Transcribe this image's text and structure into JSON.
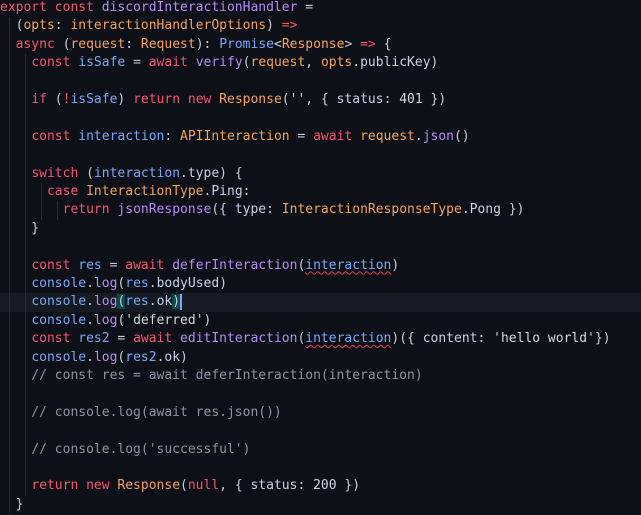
{
  "editor": {
    "current_line": 16,
    "lines": [
      [
        [
          "export const ",
          "kw"
        ],
        [
          "discordInteractionHandler",
          "fn"
        ],
        [
          " =",
          "p"
        ]
      ],
      [
        [
          "  (",
          "p"
        ],
        [
          "opts",
          "param"
        ],
        [
          ": ",
          "p"
        ],
        [
          "interactionHandlerOptions",
          "type"
        ],
        [
          ") ",
          "p"
        ],
        [
          "=>",
          "kw"
        ]
      ],
      [
        [
          "  ",
          "p"
        ],
        [
          "async",
          "kw"
        ],
        [
          " (",
          "p"
        ],
        [
          "request",
          "param"
        ],
        [
          ": ",
          "p"
        ],
        [
          "Request",
          "type"
        ],
        [
          "): ",
          "p"
        ],
        [
          "Promise",
          "var"
        ],
        [
          "<",
          "p"
        ],
        [
          "Response",
          "type"
        ],
        [
          "> ",
          "p"
        ],
        [
          "=>",
          "kw"
        ],
        [
          " {",
          "p"
        ]
      ],
      [
        [
          "    ",
          "p"
        ],
        [
          "const ",
          "kw"
        ],
        [
          "isSafe",
          "var"
        ],
        [
          " = ",
          "p"
        ],
        [
          "await ",
          "kw"
        ],
        [
          "verify",
          "fn"
        ],
        [
          "(",
          "p"
        ],
        [
          "request",
          "param"
        ],
        [
          ", ",
          "p"
        ],
        [
          "opts",
          "param"
        ],
        [
          ".",
          "p"
        ],
        [
          "publicKey",
          "prop"
        ],
        [
          ")",
          "p"
        ]
      ],
      [],
      [
        [
          "    ",
          "p"
        ],
        [
          "if ",
          "kw"
        ],
        [
          "(",
          "p"
        ],
        [
          "!",
          "op"
        ],
        [
          "isSafe",
          "var"
        ],
        [
          ") ",
          "p"
        ],
        [
          "return new ",
          "kw"
        ],
        [
          "Response",
          "type"
        ],
        [
          "(",
          "p"
        ],
        [
          "''",
          "str"
        ],
        [
          ", { ",
          "p"
        ],
        [
          "status",
          "prop"
        ],
        [
          ": ",
          "p"
        ],
        [
          "401",
          "num"
        ],
        [
          " })",
          "p"
        ]
      ],
      [],
      [
        [
          "    ",
          "p"
        ],
        [
          "const ",
          "kw"
        ],
        [
          "interaction",
          "var"
        ],
        [
          ": ",
          "p"
        ],
        [
          "APIInteraction",
          "type"
        ],
        [
          " = ",
          "p"
        ],
        [
          "await ",
          "kw"
        ],
        [
          "request",
          "param"
        ],
        [
          ".",
          "p"
        ],
        [
          "json",
          "fn"
        ],
        [
          "()",
          "p"
        ]
      ],
      [],
      [
        [
          "    ",
          "p"
        ],
        [
          "switch ",
          "kw"
        ],
        [
          "(",
          "p"
        ],
        [
          "interaction",
          "var"
        ],
        [
          ".",
          "p"
        ],
        [
          "type",
          "prop"
        ],
        [
          ") {",
          "p"
        ]
      ],
      [
        [
          "      ",
          "p"
        ],
        [
          "case ",
          "kw"
        ],
        [
          "InteractionType",
          "type"
        ],
        [
          ".",
          "p"
        ],
        [
          "Ping",
          "prop"
        ],
        [
          ":",
          "p"
        ]
      ],
      [
        [
          "        ",
          "p"
        ],
        [
          "return ",
          "kw"
        ],
        [
          "jsonResponse",
          "fn"
        ],
        [
          "({ ",
          "p"
        ],
        [
          "type",
          "prop"
        ],
        [
          ": ",
          "p"
        ],
        [
          "InteractionResponseType",
          "type"
        ],
        [
          ".",
          "p"
        ],
        [
          "Pong",
          "prop"
        ],
        [
          " })",
          "p"
        ]
      ],
      [
        [
          "    }",
          "p"
        ]
      ],
      [],
      [
        [
          "    ",
          "p"
        ],
        [
          "const ",
          "kw"
        ],
        [
          "res",
          "var"
        ],
        [
          " = ",
          "p"
        ],
        [
          "await ",
          "kw"
        ],
        [
          "deferInteraction",
          "fn"
        ],
        [
          "(",
          "p"
        ],
        [
          "interaction",
          "var squig"
        ],
        [
          ")",
          "p"
        ]
      ],
      [
        [
          "    ",
          "p"
        ],
        [
          "console",
          "var"
        ],
        [
          ".",
          "p"
        ],
        [
          "log",
          "fn"
        ],
        [
          "(",
          "p"
        ],
        [
          "res",
          "var"
        ],
        [
          ".",
          "p"
        ],
        [
          "bodyUsed",
          "prop"
        ],
        [
          ")",
          "p"
        ]
      ],
      [
        [
          "    ",
          "p"
        ],
        [
          "console",
          "var"
        ],
        [
          ".",
          "p"
        ],
        [
          "log",
          "fn"
        ],
        [
          "(",
          "p bm"
        ],
        [
          "res",
          "var"
        ],
        [
          ".",
          "p"
        ],
        [
          "ok",
          "prop"
        ],
        [
          ")",
          "p bm"
        ]
      ],
      [
        [
          "    ",
          "p"
        ],
        [
          "console",
          "var"
        ],
        [
          ".",
          "p"
        ],
        [
          "log",
          "fn"
        ],
        [
          "(",
          "p"
        ],
        [
          "'deferred'",
          "str"
        ],
        [
          ")",
          "p"
        ]
      ],
      [
        [
          "    ",
          "p"
        ],
        [
          "const ",
          "kw"
        ],
        [
          "res2",
          "var"
        ],
        [
          " = ",
          "p"
        ],
        [
          "await ",
          "kw"
        ],
        [
          "editInteraction",
          "fn"
        ],
        [
          "(",
          "p"
        ],
        [
          "interaction",
          "var squig"
        ],
        [
          ")({ ",
          "p"
        ],
        [
          "content",
          "prop"
        ],
        [
          ": ",
          "p"
        ],
        [
          "'hello world'",
          "str"
        ],
        [
          "})",
          "p"
        ]
      ],
      [
        [
          "    ",
          "p"
        ],
        [
          "console",
          "var"
        ],
        [
          ".",
          "p"
        ],
        [
          "log",
          "fn"
        ],
        [
          "(",
          "p"
        ],
        [
          "res2",
          "var"
        ],
        [
          ".",
          "p"
        ],
        [
          "ok",
          "prop"
        ],
        [
          ")",
          "p"
        ]
      ],
      [
        [
          "    // const res = await deferInteraction(interaction)",
          "cm"
        ]
      ],
      [],
      [
        [
          "    // console.log(await res.json())",
          "cm"
        ]
      ],
      [],
      [
        [
          "    // console.log('successful')",
          "cm"
        ]
      ],
      [],
      [
        [
          "    ",
          "p"
        ],
        [
          "return new ",
          "kw"
        ],
        [
          "Response",
          "type"
        ],
        [
          "(",
          "p"
        ],
        [
          "null",
          "kw"
        ],
        [
          ", { ",
          "p"
        ],
        [
          "status",
          "prop"
        ],
        [
          ": ",
          "p"
        ],
        [
          "200",
          "num"
        ],
        [
          " })",
          "p"
        ]
      ],
      [
        [
          "  }",
          "p"
        ]
      ]
    ]
  }
}
